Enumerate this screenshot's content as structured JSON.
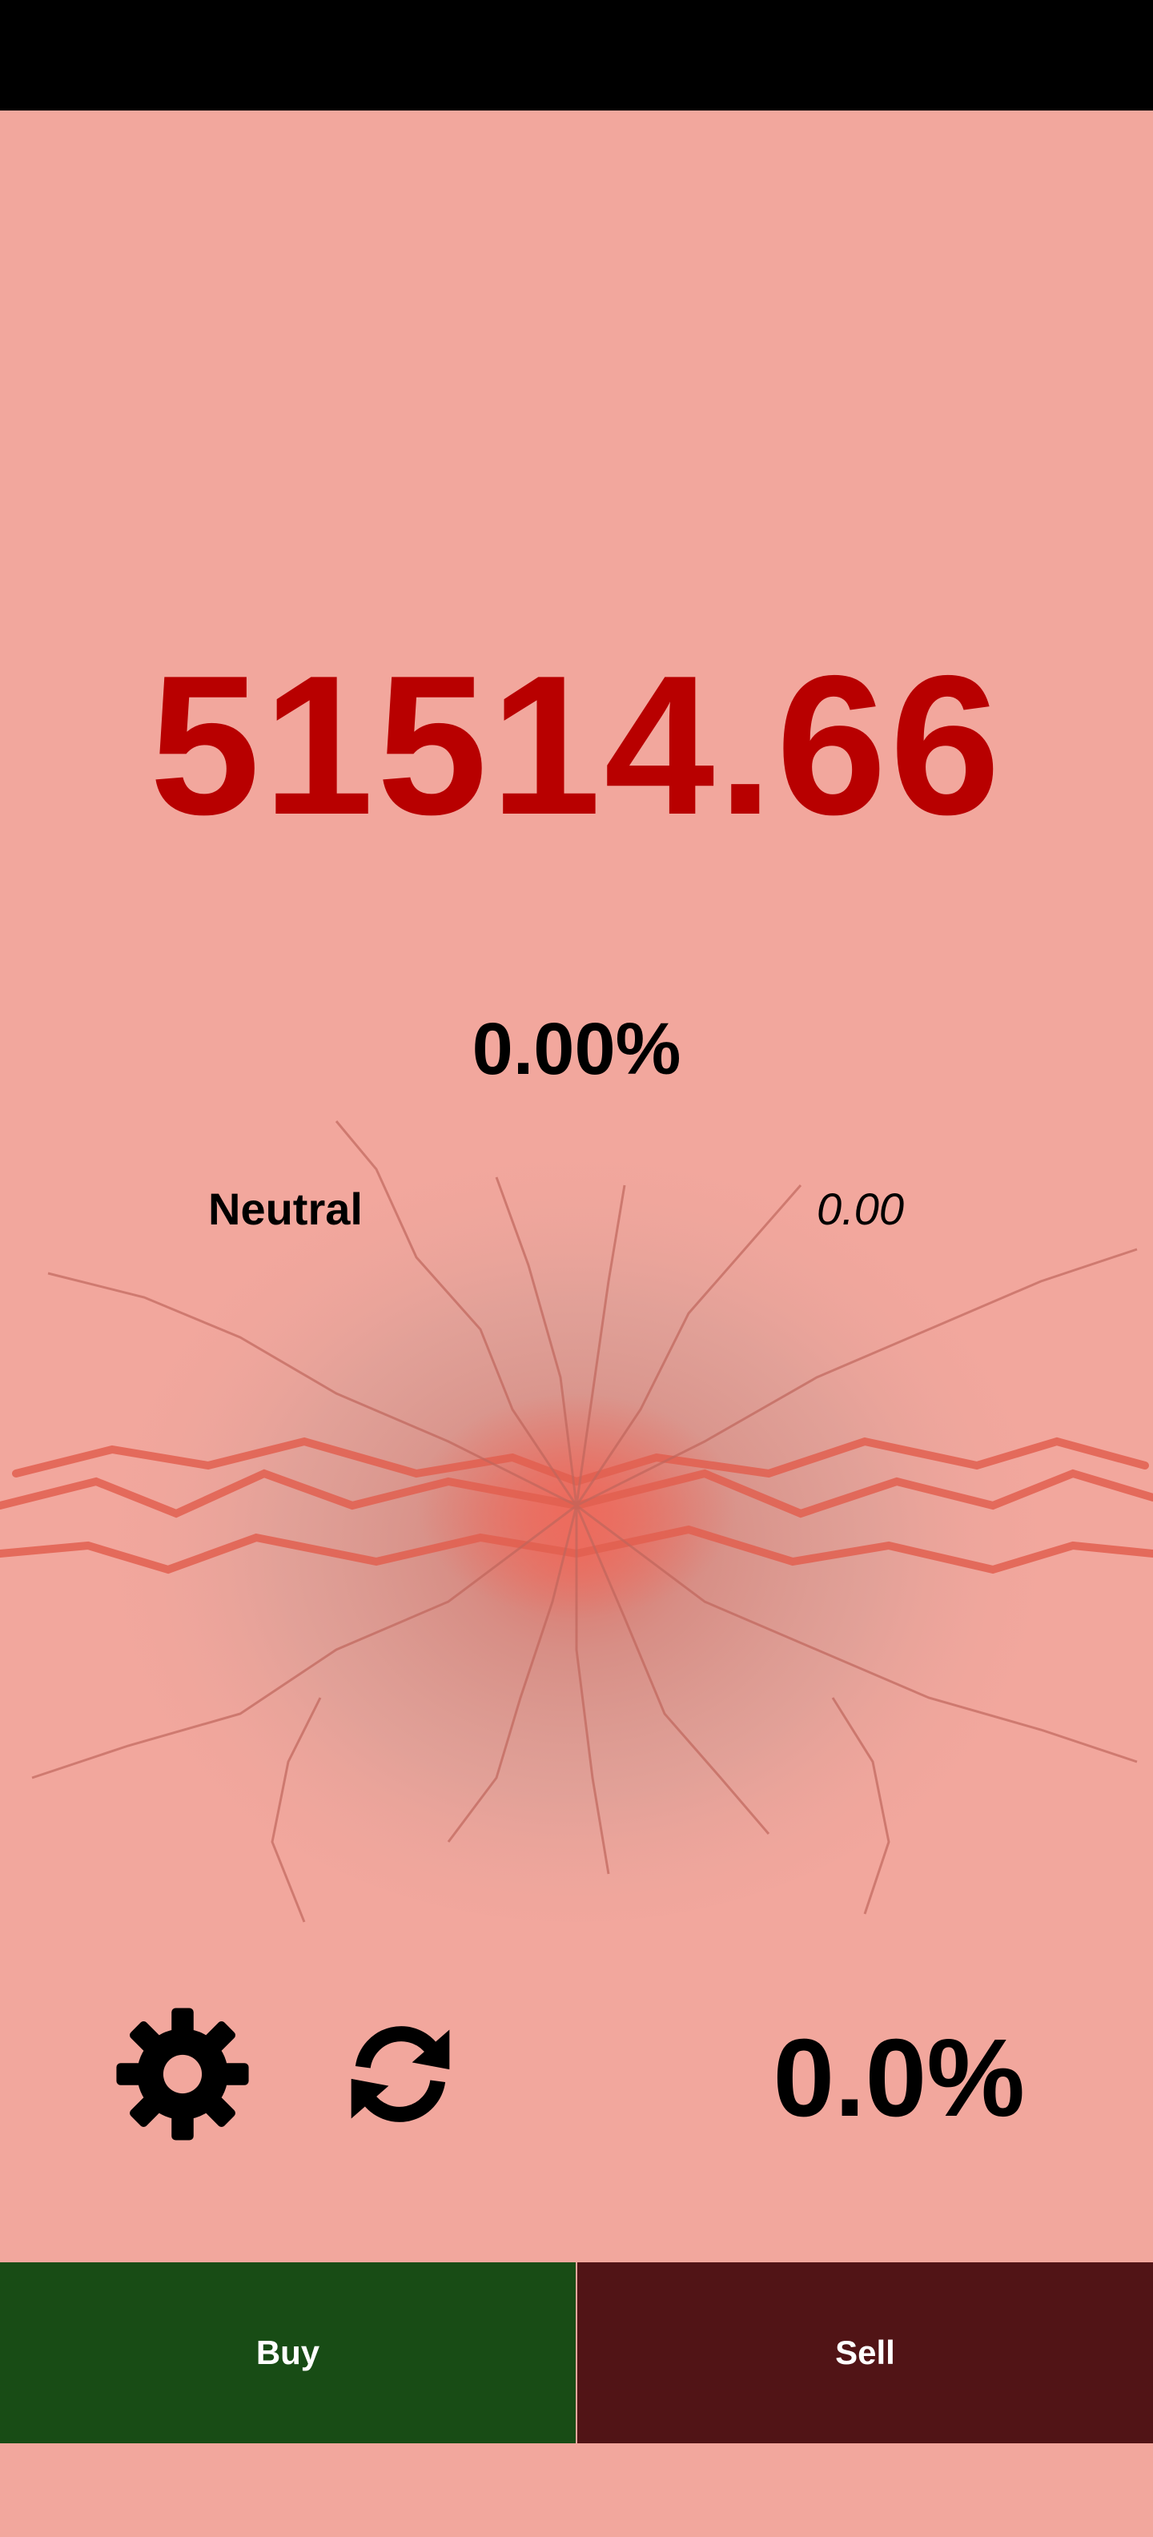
{
  "ticker": {
    "price": "51514.66",
    "change_percent": "0.00%",
    "sentiment_label": "Neutral",
    "sentiment_value": "0.00"
  },
  "toolbar": {
    "settings_icon": "gear-icon",
    "refresh_icon": "refresh-icon",
    "percent_value": "0.0%"
  },
  "actions": {
    "buy_label": "Buy",
    "sell_label": "Sell"
  },
  "colors": {
    "background": "#f2a79d",
    "price": "#b80000",
    "buy": "#184c15",
    "sell": "#511416"
  }
}
